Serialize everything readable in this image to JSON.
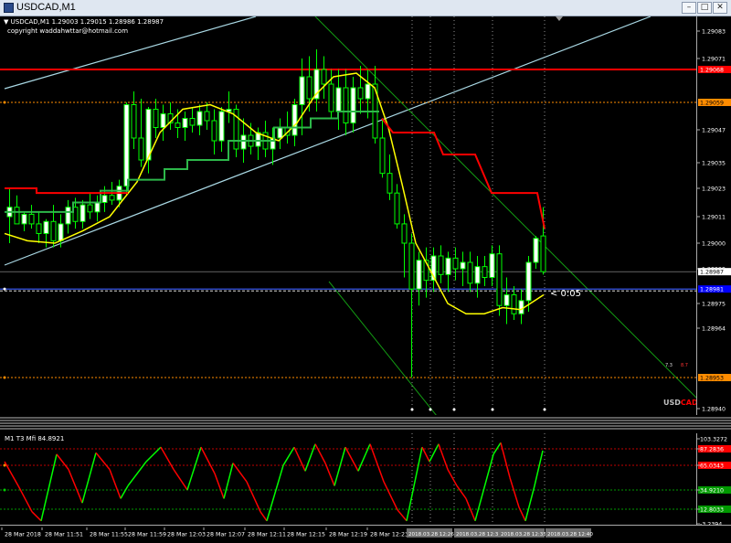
{
  "window": {
    "title": "USDCAD,M1",
    "buttons": {
      "minimize": "–",
      "maximize": "□",
      "close": "✕"
    }
  },
  "chart_header": {
    "symbol_line": "USDCAD,M1  1.29003 1.29015 1.28986 1.28987",
    "copyright": "copyright waddahwttar@hotmail.com"
  },
  "price_axis": {
    "ticks": [
      {
        "label": "1.29083",
        "value": 1.29083
      },
      {
        "label": "1.29071",
        "value": 1.29071
      },
      {
        "label": "1.29047",
        "value": 1.29047
      },
      {
        "label": "1.29035",
        "value": 1.29035
      },
      {
        "label": "1.29023",
        "value": 1.29023
      },
      {
        "label": "1.29011",
        "value": 1.29011
      },
      {
        "label": "1.29000",
        "value": 1.29
      },
      {
        "label": "1.28999",
        "value": 1.28988
      },
      {
        "label": "1.28975",
        "value": 1.28976
      },
      {
        "label": "1.28964",
        "value": 1.28964
      },
      {
        "label": "1.28940",
        "value": 1.2894
      }
    ],
    "tags": [
      {
        "name": "red-level-tag",
        "label": "1.29068",
        "value": 1.29068,
        "bg": "#ff0000",
        "fg": "#ffffff"
      },
      {
        "name": "orange-upper-tag",
        "label": "1.29059",
        "value": 1.29059,
        "bg": "#ff8c00",
        "fg": "#000000"
      },
      {
        "name": "bid-price-tag",
        "label": "1.28987",
        "value": 1.28987,
        "bg": "#ffffff",
        "fg": "#000000"
      },
      {
        "name": "blue-level-tag",
        "label": "1.28981",
        "value": 1.28981,
        "bg": "#0000ff",
        "fg": "#ffffff"
      },
      {
        "name": "orange-lower-tag",
        "label": "1.28953",
        "value": 1.28953,
        "bg": "#ff8c00",
        "fg": "#000000"
      }
    ]
  },
  "overlay_labels": {
    "spread": "< 0:05",
    "small_a": "7.3",
    "small_b": "8.7",
    "pair_usd": "USD",
    "pair_cad": "CAD"
  },
  "colors": {
    "background": "#000000",
    "bull_candle": "#ffffff",
    "bear_candle": "#000000",
    "candle_outline": "#00ff00",
    "smooth_line": "#ffff00",
    "step_green": "#2db84a",
    "step_red": "#ff0000",
    "channel_cyan": "#a9d8e4",
    "channel_green": "#139a13",
    "level_red": "#ff0000",
    "level_orange": "#ff8c00",
    "level_blue": "#3b5dff",
    "mfi_up": "#00ff00",
    "mfi_down": "#ff0000",
    "spread_label": "#ffffff",
    "usd_label": "#c0c0c0",
    "cad_label": "#ff0000"
  },
  "subwindow": {
    "label": "M1  T3 Mfi  84.8921",
    "ticks": [
      {
        "label": "103.3272",
        "value": 103.3272,
        "bg": "",
        "fg": "#ffffff"
      },
      {
        "label": "87.2836",
        "value": 87.2836,
        "bg": "#ff0000",
        "fg": "#ffffff"
      },
      {
        "label": "65.0343",
        "value": 65.0343,
        "bg": "#ff0000",
        "fg": "#ffffff"
      },
      {
        "label": "34.9210",
        "value": 34.921,
        "bg": "#009900",
        "fg": "#ffffff"
      },
      {
        "label": "12.8033",
        "value": 12.8033,
        "bg": "#009900",
        "fg": "#ffffff"
      },
      {
        "label": "-3.2394",
        "value": -3.2394,
        "bg": "",
        "fg": "#ffffff"
      }
    ]
  },
  "time_axis": {
    "labels": [
      "28 Mar 2018",
      "28 Mar 11:51",
      "28 Mar 11:55",
      "28 Mar 11:59",
      "28 Mar 12:03",
      "28 Mar 12:07",
      "28 Mar 12:11",
      "28 Mar 12:15",
      "28 Mar 12:19",
      "28 Mar 12:23"
    ],
    "highlighted": [
      "2018.03.28 12:26",
      "2018.03.28 12:31",
      "2018.03.28 12:35",
      "2018.03.28 12:40"
    ]
  }
}
